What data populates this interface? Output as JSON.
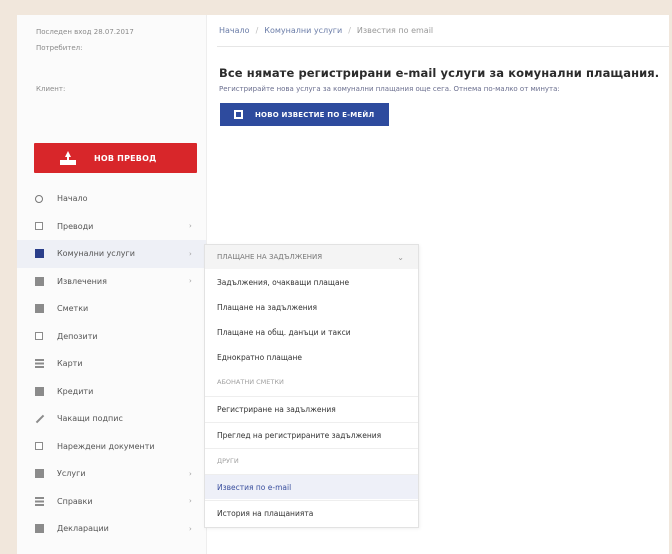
{
  "sidebar": {
    "info_line1": "Последен вход 28.07.2017",
    "info_line2": "Потребител:",
    "info_line3": "Клиент:",
    "new_transfer_label": "НОВ ПРЕВОД",
    "items": [
      {
        "label": "Начало",
        "icon": "home-icon",
        "chevron": false
      },
      {
        "label": "Преводи",
        "icon": "transfers-icon",
        "chevron": true
      },
      {
        "label": "Комунални услуги",
        "icon": "utilities-icon",
        "chevron": true
      },
      {
        "label": "Извлечения",
        "icon": "statements-icon",
        "chevron": true
      },
      {
        "label": "Сметки",
        "icon": "accounts-icon",
        "chevron": false
      },
      {
        "label": "Депозити",
        "icon": "deposits-icon",
        "chevron": false
      },
      {
        "label": "Карти",
        "icon": "cards-icon",
        "chevron": false
      },
      {
        "label": "Кредити",
        "icon": "loans-icon",
        "chevron": false
      },
      {
        "label": "Чакащи подпис",
        "icon": "pen-icon",
        "chevron": false
      },
      {
        "label": "Нареждени документи",
        "icon": "documents-icon",
        "chevron": false
      },
      {
        "label": "Услуги",
        "icon": "services-icon",
        "chevron": true
      },
      {
        "label": "Справки",
        "icon": "reports-icon",
        "chevron": true
      },
      {
        "label": "Декларации",
        "icon": "declarations-icon",
        "chevron": true
      }
    ]
  },
  "breadcrumb": {
    "items": [
      "Начало",
      "Комунални услуги",
      "Известия по email"
    ],
    "separator": "/"
  },
  "main": {
    "heading": "Все нямате регистрирани e-mail услуги за комунални плащания.",
    "subtext": "Регистрирайте нова услуга за комунални плащания още сега. Отнема по-малко от минута:",
    "button_label": "НОВО ИЗВЕСТИЕ ПО Е-МЕЙЛ"
  },
  "dropdown": {
    "header": "ПЛАЩАНЕ НА ЗАДЪЛЖЕНИЯ",
    "items": [
      "Задължения, очакващи плащане",
      "Плащане на задължения",
      "Плащане на общ. данъци и такси",
      "Еднократно плащане"
    ],
    "section2": "АБОНАТНИ СМЕТКИ",
    "items2": [
      "Регистриране на задължения",
      "Преглед на регистрираните задължения"
    ],
    "section3": "ДРУГИ",
    "items3": [
      "Известия по e-mail",
      "История на плащанията"
    ]
  },
  "colors": {
    "accent_red": "#d8262a",
    "accent_blue": "#2e4b9e"
  }
}
